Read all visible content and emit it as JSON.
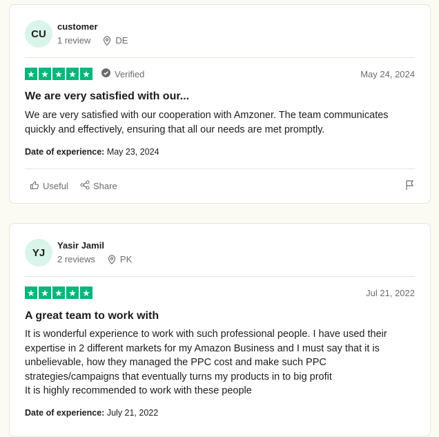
{
  "reviews": [
    {
      "initials": "CU",
      "name": "customer",
      "review_count": "1 review",
      "country": "DE",
      "stars": [
        "★",
        "★",
        "★",
        "★",
        "★"
      ],
      "rating": 5,
      "verified": "Verified",
      "date": "May 24, 2024",
      "title": "We are very satisfied with our...",
      "body": "We are very satisfied with our cooperation with Amzoner. The team communicates quickly and effectively, ensuring that all our needs are met promptly.",
      "experience_label": "Date of experience:",
      "experience_date": "May 23, 2024",
      "useful_label": "Useful",
      "share_label": "Share"
    },
    {
      "initials": "YJ",
      "name": "Yasir Jamil",
      "review_count": "2 reviews",
      "country": "PK",
      "stars": [
        "★",
        "★",
        "★",
        "★",
        "★"
      ],
      "rating": 5,
      "date": "Jul 21, 2022",
      "title": "A great team to work with",
      "body": "It is wonderful experience to work with such professional people. I have used their expertise in 2 different markets for my Amazon Business and I must say that it is unbelievable, how they managed the PPC cost and make such PPC strategies/campaigns that eventually turns my products in to big profit\nIt is highly recommended to work with these people",
      "experience_label": "Date of experience:",
      "experience_date": "July 21, 2022"
    }
  ],
  "colors": {
    "star_green": "#00b67a",
    "avatar_bg": "#d9f5e9"
  }
}
